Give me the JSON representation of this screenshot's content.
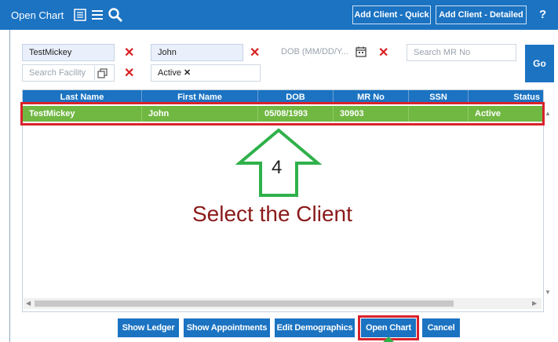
{
  "header": {
    "title": "Open Chart",
    "add_quick": "Add Client - Quick",
    "add_detailed": "Add Client - Detailed",
    "help": "?"
  },
  "filters": {
    "last_name": "TestMickey",
    "first_name": "John",
    "dob_placeholder": "DOB (MM/DD/Y...",
    "mr_placeholder": "Search MR No",
    "facility_placeholder": "Search Facility",
    "status_tag": "Active",
    "go_label": "Go"
  },
  "grid": {
    "columns": [
      "Last Name",
      "First Name",
      "DOB",
      "MR No",
      "SSN",
      "Status"
    ],
    "rows": [
      {
        "last_name": "TestMickey",
        "first_name": "John",
        "dob": "05/08/1993",
        "mr_no": "30903",
        "ssn": "",
        "status": "Active"
      }
    ]
  },
  "annotation": {
    "step": "4",
    "instruction": "Select the Client"
  },
  "actions": {
    "show_ledger": "Show Ledger",
    "show_appointments": "Show Appointments",
    "edit_demographics": "Edit Demographics",
    "open_chart": "Open Chart",
    "cancel": "Cancel"
  },
  "colors": {
    "header_blue": "#1b73c2",
    "selected_row_green": "#71b843",
    "highlight_red": "#d9232b",
    "arrow_green": "#2fb14a"
  }
}
